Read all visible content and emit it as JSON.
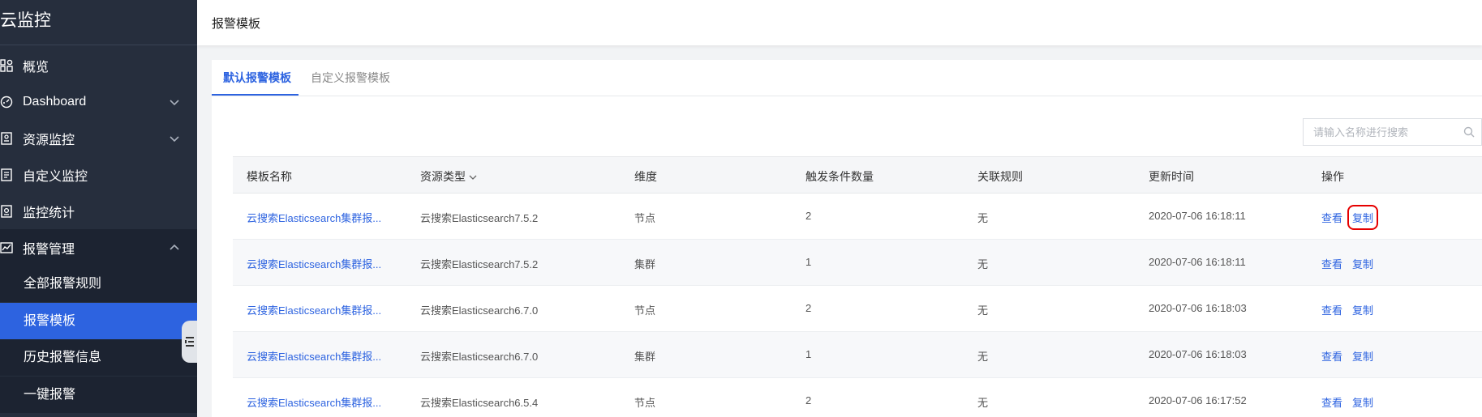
{
  "sidebar": {
    "title": "云监控",
    "items": [
      {
        "label": "概览",
        "icon": "overview-grid-icon"
      },
      {
        "label": "Dashboard",
        "icon": "dashboard-gauge-icon"
      },
      {
        "label": "资源监控",
        "icon": "resource-monitor-icon"
      },
      {
        "label": "自定义监控",
        "icon": "custom-monitor-icon"
      },
      {
        "label": "监控统计",
        "icon": "statistics-icon"
      },
      {
        "label": "报警管理",
        "icon": "alarm-chart-icon"
      }
    ],
    "sub_items": [
      {
        "label": "全部报警规则"
      },
      {
        "label": "报警模板"
      },
      {
        "label": "历史报警信息"
      },
      {
        "label": "一键报警"
      }
    ],
    "active_color": "#2d63e0",
    "bg_color": "#262e3d"
  },
  "header": {
    "breadcrumb": "报警模板"
  },
  "tabs": [
    {
      "label": "默认报警模板",
      "active": true
    },
    {
      "label": "自定义报警模板",
      "active": false
    }
  ],
  "search": {
    "placeholder": "请输入名称进行搜索",
    "value": ""
  },
  "table": {
    "columns": [
      "模板名称",
      "资源类型",
      "维度",
      "触发条件数量",
      "关联规则",
      "更新时间",
      "操作"
    ],
    "rows": [
      {
        "name": "云搜索Elasticsearch集群报...",
        "type": "云搜索Elasticsearch7.5.2",
        "dimension": "节点",
        "count": "2",
        "rule": "无",
        "updated": "2020-07-06 16:18:11",
        "view": "查看",
        "copy": "复制"
      },
      {
        "name": "云搜索Elasticsearch集群报...",
        "type": "云搜索Elasticsearch7.5.2",
        "dimension": "集群",
        "count": "1",
        "rule": "无",
        "updated": "2020-07-06 16:18:11",
        "view": "查看",
        "copy": "复制"
      },
      {
        "name": "云搜索Elasticsearch集群报...",
        "type": "云搜索Elasticsearch6.7.0",
        "dimension": "节点",
        "count": "2",
        "rule": "无",
        "updated": "2020-07-06 16:18:03",
        "view": "查看",
        "copy": "复制"
      },
      {
        "name": "云搜索Elasticsearch集群报...",
        "type": "云搜索Elasticsearch6.7.0",
        "dimension": "集群",
        "count": "1",
        "rule": "无",
        "updated": "2020-07-06 16:18:03",
        "view": "查看",
        "copy": "复制"
      },
      {
        "name": "云搜索Elasticsearch集群报...",
        "type": "云搜索Elasticsearch6.5.4",
        "dimension": "节点",
        "count": "2",
        "rule": "无",
        "updated": "2020-07-06 16:17:52",
        "view": "查看",
        "copy": "复制"
      }
    ]
  },
  "colors": {
    "accent": "#2d63e0",
    "highlight": "#e60000"
  }
}
